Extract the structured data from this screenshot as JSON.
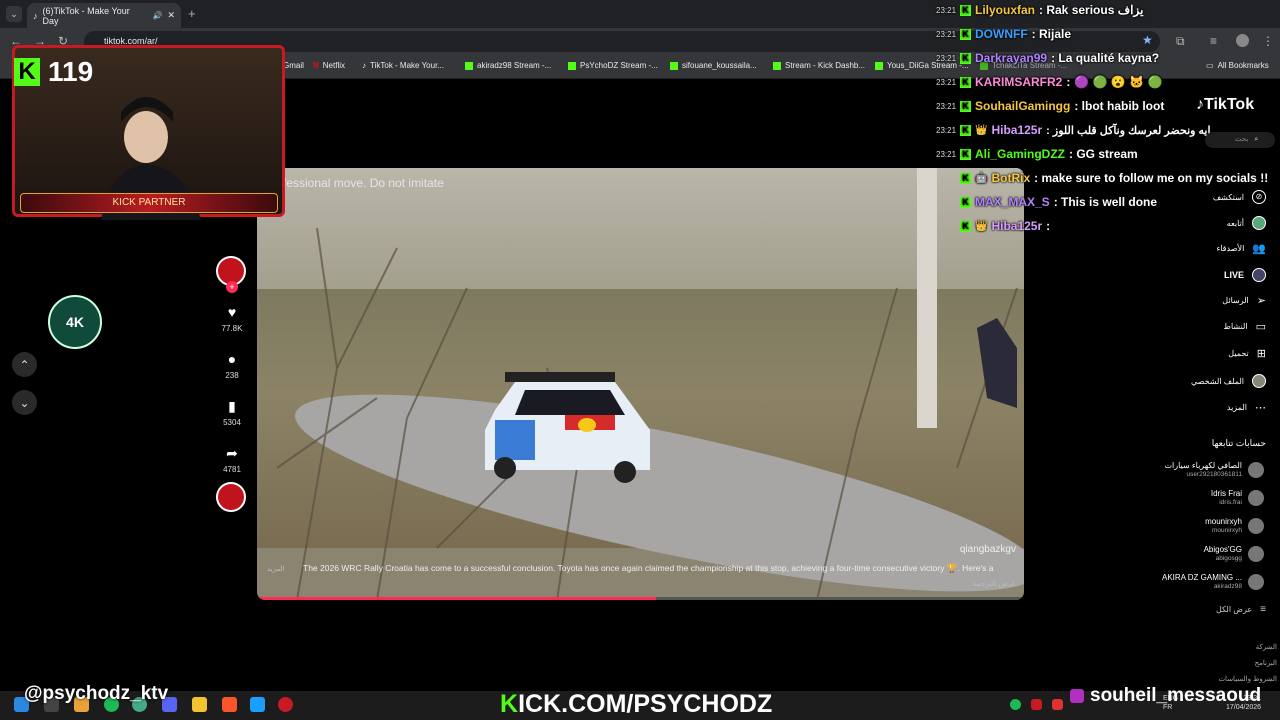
{
  "browser": {
    "tab_title": "(6)TikTok - Make Your Day",
    "url": "tiktok.com/ar/",
    "all_bookmarks": "All Bookmarks",
    "bookmarks": [
      {
        "label": "Gmail",
        "icon": "gmail-icon"
      },
      {
        "label": "Netflix",
        "icon": "netflix-icon"
      },
      {
        "label": "TikTok - Make Your...",
        "icon": "tiktok-icon"
      },
      {
        "label": "akiradz98 Stream -...",
        "icon": "kick-icon"
      },
      {
        "label": "PsYchoDZ Stream -...",
        "icon": "kick-icon"
      },
      {
        "label": "sifouane_koussaila...",
        "icon": "kick-icon"
      },
      {
        "label": "Stream - Kick Dashb...",
        "icon": "kick-icon"
      },
      {
        "label": "Yous_DiiGa Stream -...",
        "icon": "kick-icon"
      },
      {
        "label": "TchakLiTa Stream -...",
        "icon": "kick-icon"
      }
    ]
  },
  "overlay": {
    "viewer_count": "119",
    "partner_label": "KICK PARTNER",
    "handle": "@psychodz_ktv",
    "kick_url_k": "K",
    "kick_url_rest": "ICK.COM/PSYCHODZ",
    "streamer_name": "souheil_messaoud",
    "accent_color": "#53fc18"
  },
  "chat": [
    {
      "time": "23:21",
      "user": "Lilyouxfan",
      "color": "#f5c842",
      "msg": ": Rak serious يزاف"
    },
    {
      "time": "23:21",
      "user": "DOWNFF",
      "color": "#3aa0ff",
      "msg": ": Rijale"
    },
    {
      "time": "23:21",
      "user": "Darkrayan99",
      "color": "#b084ff",
      "msg": ": La qualité kayna?"
    },
    {
      "time": "23:21",
      "user": "KARIMSARFR2",
      "color": "#ff8ad8",
      "msg": ":"
    },
    {
      "time": "23:21",
      "user": "SouhailGamingg",
      "color": "#f5c842",
      "msg": ": lbot habib loot"
    },
    {
      "time": "23:21",
      "user": "Hiba125r",
      "color": "#d69cff",
      "msg": ": ايه ونحضر لعرسك ونآكل قلب اللوز"
    },
    {
      "time": "23:21",
      "user": "Ali_GamingDZZ",
      "color": "#53fc18",
      "msg": ": GG stream"
    },
    {
      "time": "",
      "user": "BotRix",
      "color": "#f5c842",
      "msg": ": make sure to follow me on my socials !!"
    },
    {
      "time": "",
      "user": "MAX_MAX_S",
      "color": "#b084ff",
      "msg": ": This is well done"
    },
    {
      "time": "",
      "user": "Hiba125r",
      "color": "#d69cff",
      "msg": ":"
    }
  ],
  "video": {
    "top_text": "fessional move. Do not imitate",
    "watermark": "qiangbazkgv",
    "more": "المزيد",
    "caption": "The 2026 WRC Rally Croatia has come to a successful conclusion. Toyota has once again claimed the championship at this stop, achieving a four-time consecutive victory 🏆. Here's a",
    "translate": "عرض الترجمة",
    "progress": 0.52
  },
  "actions": {
    "likes": "77.8K",
    "comments": "238",
    "saves": "5304",
    "shares": "4781"
  },
  "tiktok": {
    "brand": "TikTok",
    "search_placeholder": "بحث",
    "sidebar": [
      {
        "label": "استكشف",
        "icon": "compass-icon"
      },
      {
        "label": "أتابعه",
        "icon": "following-icon"
      },
      {
        "label": "الأصدقاء",
        "icon": "friends-icon"
      },
      {
        "label": "LIVE",
        "icon": "live-icon"
      },
      {
        "label": "الرسائل",
        "icon": "messages-icon"
      },
      {
        "label": "النشاط",
        "icon": "activity-icon"
      },
      {
        "label": "تحميل",
        "icon": "upload-icon"
      },
      {
        "label": "الملف الشخصي",
        "icon": "profile-icon"
      },
      {
        "label": "المزيد",
        "icon": "more-icon"
      }
    ],
    "following_title": "حسابات تتابعها",
    "following": [
      {
        "name": "الصافي لكهرباء سيارات",
        "handle": "user292180361811"
      },
      {
        "name": "Idris Frai",
        "handle": "idris.frai"
      },
      {
        "name": "mounirxyh",
        "handle": "mounirxyh"
      },
      {
        "name": "Abigos'GG",
        "handle": "abigosgg"
      },
      {
        "name": "AKIRA DZ GAMING ...",
        "handle": "akiradz98"
      }
    ],
    "see_all": "عرض الكل",
    "footer": [
      "الشركة",
      "البرنامج",
      "الشروط والسياسات"
    ]
  },
  "taskbar": {
    "lang_top": "ENG",
    "lang_bottom": "FR",
    "time": "23:21",
    "date": "17/04/2026"
  }
}
